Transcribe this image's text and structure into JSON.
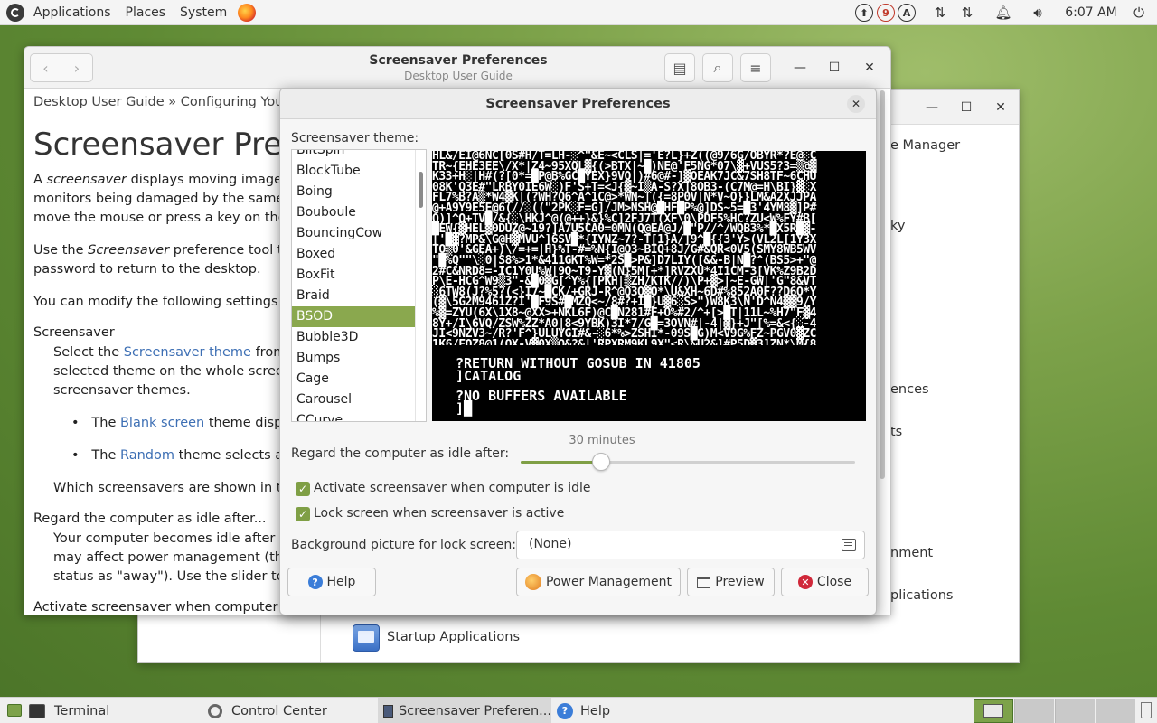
{
  "top_panel": {
    "menus": [
      "Applications",
      "Places",
      "System"
    ],
    "notification_count": "9",
    "clock": "6:07 AM"
  },
  "help_window": {
    "title": "Screensaver Preferences",
    "subtitle": "Desktop User Guide",
    "breadcrumb": "Desktop User Guide » Configuring Your D",
    "heading": "Screensaver Pref",
    "para1": {
      "l1_a": "A ",
      "l1_em": "screensaver",
      "l1_b": " displays moving images or",
      "l2": "monitors being damaged by the same im",
      "l3": "move the mouse or press a key on the ke"
    },
    "para2": {
      "l1_a": "Use the ",
      "l1_em": "Screensaver",
      "l1_b": " preference tool to se",
      "l2": "password to return to the desktop."
    },
    "para3": "You can modify the following settings:",
    "term1": "Screensaver",
    "def1": {
      "l1_a": "Select the ",
      "l1_link": "Screensaver theme",
      "l1_b": " from th",
      "l2": "selected theme on the whole screen.",
      "l3": "screensaver themes."
    },
    "bullet1": {
      "a": "The ",
      "link": "Blank screen",
      "b": " theme displays"
    },
    "bullet2": {
      "a": "The ",
      "link": "Random",
      "b": " theme selects a scr"
    },
    "which": "Which screensavers are shown in the",
    "term2": "Regard the computer as idle after...",
    "def2": {
      "l1": "Your computer becomes idle after thi",
      "l2": "may affect power management (the n",
      "l3": "status as \"away\"). Use the slider to se"
    },
    "term3": "Activate screensaver when computer is idle"
  },
  "control_center": {
    "items": [
      "e Manager",
      "ky",
      "ences",
      "ts",
      "nment",
      "plications"
    ],
    "startup": "Startup Applications"
  },
  "dialog": {
    "title": "Screensaver Preferences",
    "theme_label": "Screensaver theme:",
    "themes": [
      "BlitSpin",
      "BlockTube",
      "Boing",
      "Bouboule",
      "BouncingCow",
      "Boxed",
      "BoxFit",
      "Braid",
      "BSOD",
      "Bubble3D",
      "Bumps",
      "Cage",
      "Carousel",
      "CCurve"
    ],
    "selected_theme": "BSOD",
    "preview_text": {
      "line1": "?RETURN WITHOUT GOSUB IN 41805",
      "line2": "]CATALOG",
      "line3": "?NO BUFFERS AVAILABLE",
      "line4": "]█"
    },
    "idle_label": "Regard the computer as idle after:",
    "idle_value_text": "30 minutes",
    "idle_fraction": 0.24,
    "activate_label": "Activate screensaver when computer is idle",
    "activate_checked": true,
    "lock_label": "Lock screen when screensaver is active",
    "lock_checked": true,
    "bg_label": "Background picture for lock screen:",
    "bg_value": "(None)",
    "buttons": {
      "help": "Help",
      "power": "Power Management",
      "preview": "Preview",
      "close": "Close"
    },
    "colors": {
      "accent": "#8aa84e",
      "close_red": "#d0283a",
      "help_blue": "#3b7dd8"
    }
  },
  "taskbar": {
    "tasks": [
      "Terminal",
      "Control Center",
      "Screensaver Preferen...",
      "Help"
    ]
  }
}
